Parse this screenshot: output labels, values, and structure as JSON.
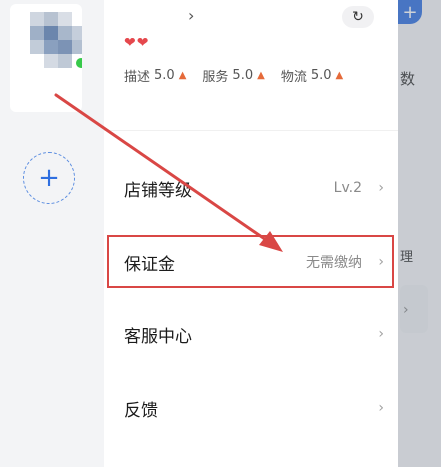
{
  "store_header": {
    "chevron": "›",
    "refresh_icon": "↻",
    "hearts": "❤❤",
    "ratings": [
      {
        "label": "描述",
        "value": "5.0",
        "trend": "▲"
      },
      {
        "label": "服务",
        "value": "5.0",
        "trend": "▲"
      },
      {
        "label": "物流",
        "value": "5.0",
        "trend": "▲"
      }
    ]
  },
  "menu": {
    "items": [
      {
        "label": "店铺等级",
        "value": "Lv.2",
        "chevron": "›"
      },
      {
        "label": "保证金",
        "value": "无需缴纳",
        "chevron": "›"
      },
      {
        "label": "客服中心",
        "value": "",
        "chevron": "›"
      },
      {
        "label": "反馈",
        "value": "",
        "chevron": "›"
      }
    ]
  },
  "sidebar": {
    "add_label": "+"
  },
  "background_page": {
    "plus": "+",
    "text_partial_1": "数",
    "text_partial_2": "理",
    "chevron": "›"
  },
  "colors": {
    "accent": "#2f6fe0",
    "annotation": "#d94745",
    "heart": "#e5484d"
  }
}
